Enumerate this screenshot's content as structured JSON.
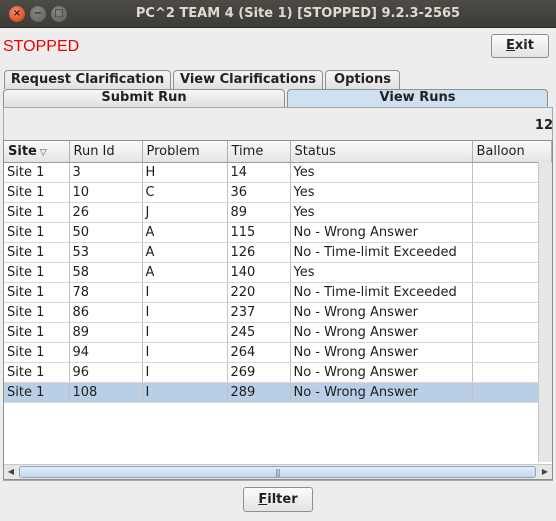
{
  "window": {
    "title": "PC^2 TEAM 4 (Site 1) [STOPPED] 9.2.3-2565",
    "close_glyph": "×",
    "minimize_glyph": "−",
    "maximize_glyph": "□"
  },
  "status": {
    "text": "STOPPED",
    "color": "#ee0000"
  },
  "exit_button": {
    "label": "Exit"
  },
  "tabs_row1": [
    {
      "label": "Request Clarification"
    },
    {
      "label": "View Clarifications"
    },
    {
      "label": "Options"
    }
  ],
  "tabs_row2": [
    {
      "label": "Submit Run"
    },
    {
      "label": "View Runs",
      "selected": true
    }
  ],
  "runs_count": "12",
  "table": {
    "columns": [
      "Site",
      "Run Id",
      "Problem",
      "Time",
      "Status",
      "Balloon"
    ],
    "sort_indicator": "▽",
    "rows": [
      {
        "site": "Site 1",
        "run_id": "3",
        "problem": "H",
        "time": "14",
        "status": "Yes",
        "balloon": ""
      },
      {
        "site": "Site 1",
        "run_id": "10",
        "problem": "C",
        "time": "36",
        "status": "Yes",
        "balloon": ""
      },
      {
        "site": "Site 1",
        "run_id": "26",
        "problem": "J",
        "time": "89",
        "status": "Yes",
        "balloon": ""
      },
      {
        "site": "Site 1",
        "run_id": "50",
        "problem": "A",
        "time": "115",
        "status": "No - Wrong Answer",
        "balloon": ""
      },
      {
        "site": "Site 1",
        "run_id": "53",
        "problem": "A",
        "time": "126",
        "status": "No - Time-limit Exceeded",
        "balloon": ""
      },
      {
        "site": "Site 1",
        "run_id": "58",
        "problem": "A",
        "time": "140",
        "status": "Yes",
        "balloon": ""
      },
      {
        "site": "Site 1",
        "run_id": "78",
        "problem": "I",
        "time": "220",
        "status": "No - Time-limit Exceeded",
        "balloon": ""
      },
      {
        "site": "Site 1",
        "run_id": "86",
        "problem": "I",
        "time": "237",
        "status": "No - Wrong Answer",
        "balloon": ""
      },
      {
        "site": "Site 1",
        "run_id": "89",
        "problem": "I",
        "time": "245",
        "status": "No - Wrong Answer",
        "balloon": ""
      },
      {
        "site": "Site 1",
        "run_id": "94",
        "problem": "I",
        "time": "264",
        "status": "No - Wrong Answer",
        "balloon": ""
      },
      {
        "site": "Site 1",
        "run_id": "96",
        "problem": "I",
        "time": "269",
        "status": "No - Wrong Answer",
        "balloon": ""
      },
      {
        "site": "Site 1",
        "run_id": "108",
        "problem": "I",
        "time": "289",
        "status": "No - Wrong Answer",
        "balloon": "",
        "selected": true
      }
    ]
  },
  "scrollbar": {
    "left_arrow": "◀",
    "right_arrow": "▶",
    "grip": "|||"
  },
  "filter_button": {
    "label": "Filter"
  }
}
